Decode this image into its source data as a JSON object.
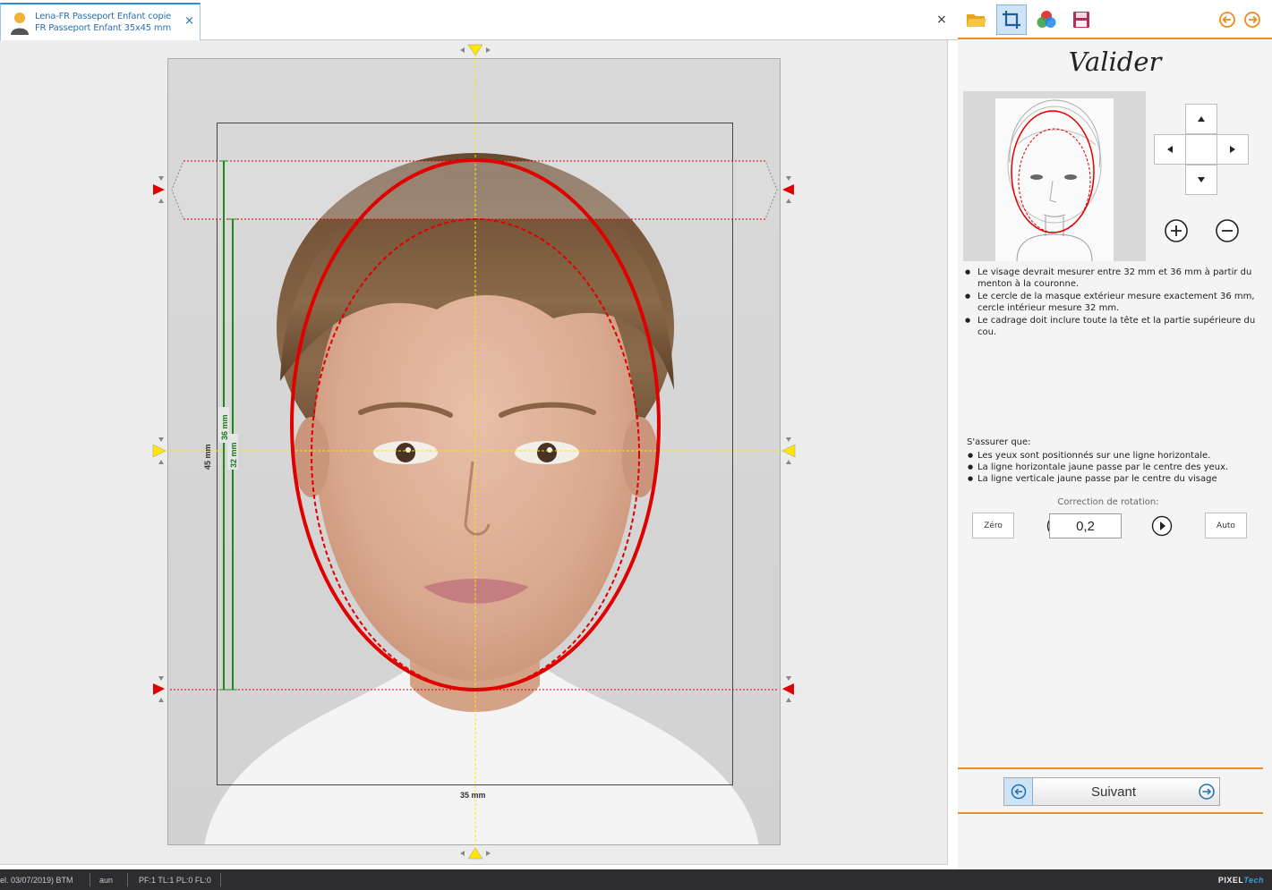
{
  "tab": {
    "line1": "Lena-FR Passeport Enfant copie",
    "line2": "FR Passeport Enfant 35x45 mm",
    "close": "×"
  },
  "close_all": "×",
  "measurements": {
    "height_outer": "36 mm",
    "height_inner": "32 mm",
    "height_total": "45 mm",
    "width_total": "35 mm"
  },
  "panel": {
    "title": "Valider",
    "guidelines": [
      "Le visage devrait mesurer entre 32 mm et 36 mm à partir du menton à la couronne.",
      "Le cercle de la masque extérieur mesure exactement 36 mm, cercle intérieur mesure 32 mm.",
      "Le cadrage doit inclure toute la tête et la partie supérieure du cou."
    ],
    "ensure_title": "S'assurer que:",
    "ensure_items": [
      "Les yeux sont positionnés sur une ligne horizontale.",
      "La ligne horizontale jaune passe par le centre des yeux.",
      "La ligne verticale jaune passe par le centre du visage"
    ],
    "rotation_label": "Correction de rotation:",
    "rotation_value": "0,2",
    "zero_label": "Zéro",
    "auto_label": "Auto",
    "next_label": "Suivant"
  },
  "status": {
    "s1": "el. 03/07/2019) BTM",
    "s2": "aun",
    "s3": "PF:1 TL:1 PL:0 FL:0",
    "brand_a": "PIXEL",
    "brand_b": "Tech"
  },
  "colors": {
    "accent": "#f08a24",
    "guide_red": "#e00000",
    "guide_yellow": "#ffe600",
    "guide_green": "#1a8a1a",
    "tab_blue": "#2b6fb5"
  }
}
